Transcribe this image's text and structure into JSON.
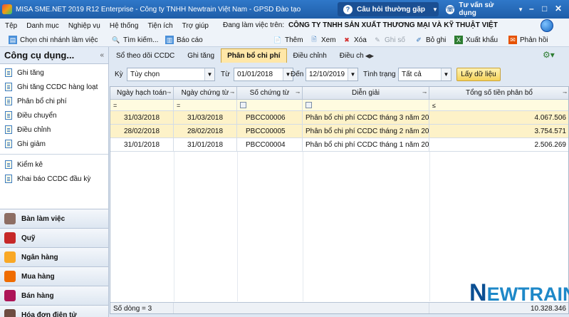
{
  "titlebar": {
    "title": "MISA SME.NET 2019 R12 Enterprise - Công ty TNHH Newtrain Việt Nam - GPSD Đào tạo",
    "faq": "Câu hỏi thường gặp",
    "consult": "Tư vấn sử dụng"
  },
  "menu": [
    "Tệp",
    "Danh mục",
    "Nghiệp vụ",
    "Hệ thống",
    "Tiện ích",
    "Trợ giúp"
  ],
  "company": {
    "label": "Đang làm việc trên:",
    "name": "CÔNG TY TNHH SẢN XUẤT THƯƠNG MẠI VÀ KỸ THUẬT VIỆT"
  },
  "toolbar": {
    "branch": "Chọn chi nhánh làm việc",
    "search": "Tìm kiếm...",
    "report": "Báo cáo",
    "add": "Thêm",
    "view": "Xem",
    "delete": "Xóa",
    "post": "Ghi số",
    "unpost": "Bỏ ghi",
    "export": "Xuất khẩu",
    "feedback": "Phản hồi"
  },
  "left_panel": {
    "title": "Công cụ dụng...",
    "items": [
      "Ghi tăng",
      "Ghi tăng CCDC hàng loạt",
      "Phân bổ chi phí",
      "Điều chuyển",
      "Điều chỉnh",
      "Ghi giảm"
    ],
    "items2": [
      "Kiểm kê",
      "Khai báo CCDC đầu kỳ"
    ],
    "modules": [
      "Bàn làm việc",
      "Quỹ",
      "Ngân hàng",
      "Mua hàng",
      "Bán hàng",
      "Hóa đơn điện tử"
    ]
  },
  "tabs": [
    "Sổ theo dõi CCDC",
    "Ghi tăng",
    "Phân bổ chi phí",
    "Điều chỉnh",
    "Điều ch"
  ],
  "active_tab": "Phân bổ chi phí",
  "filters": {
    "period_label": "Kỳ",
    "period_value": "Tùy chọn",
    "from_label": "Từ",
    "from_value": "01/01/2018",
    "to_label": "Đến",
    "to_value": "12/10/2019",
    "status_label": "Tình trạng",
    "status_value": "Tất cả",
    "get_data": "Lấy dữ liệu"
  },
  "grid": {
    "columns": [
      "Ngày hạch toán",
      "Ngày chứng từ",
      "Số chứng từ",
      "Diễn giải",
      "Tổng số tiền phân bổ"
    ],
    "filter_ops": [
      "=",
      "=",
      "",
      "",
      "≤"
    ],
    "rows": [
      [
        "31/03/2018",
        "31/03/2018",
        "PBCC00006",
        "Phân bổ chi phí CCDC tháng 3 năm 20...",
        "4.067.506"
      ],
      [
        "28/02/2018",
        "28/02/2018",
        "PBCC00005",
        "Phân bổ chi phí CCDC tháng 2 năm 20...",
        "3.754.571"
      ],
      [
        "31/01/2018",
        "31/01/2018",
        "PBCC00004",
        "Phân bổ chi phí CCDC tháng 1 năm 20...",
        "2.506.269"
      ]
    ],
    "row_count": "Số dòng = 3",
    "total": "10.328.346"
  },
  "logo": {
    "first": "N",
    "rest": "EWTRAIN"
  },
  "colors": {
    "titlebar": "#1f5ea8",
    "active_tab": "#ffe7a8",
    "highlight_row": "#fdf2c8"
  }
}
